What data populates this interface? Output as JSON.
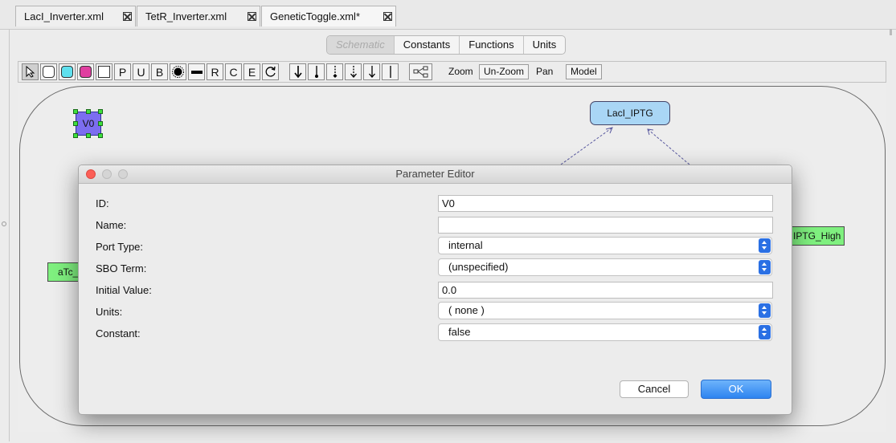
{
  "file_tabs": [
    {
      "label": "LacI_Inverter.xml"
    },
    {
      "label": "TetR_Inverter.xml"
    },
    {
      "label": "GeneticToggle.xml*"
    }
  ],
  "mode_tabs": [
    "Schematic",
    "Constants",
    "Functions",
    "Units"
  ],
  "toolbar": {
    "letter_tools": [
      "P",
      "U",
      "B",
      "R",
      "C",
      "E"
    ],
    "zoom": "Zoom",
    "unzoom": "Un-Zoom",
    "pan": "Pan",
    "model": "Model"
  },
  "canvas": {
    "v0_label": "V0",
    "lacl_label": "LacI_IPTG",
    "atc_label": "aTc_",
    "iptg_label": "IPTG_High"
  },
  "dialog": {
    "title": "Parameter Editor",
    "fields": {
      "id": {
        "label": "ID:",
        "value": "V0"
      },
      "name": {
        "label": "Name:",
        "value": ""
      },
      "port_type": {
        "label": "Port Type:",
        "value": "internal"
      },
      "sbo_term": {
        "label": "SBO Term:",
        "value": "(unspecified)"
      },
      "initial_value": {
        "label": "Initial Value:",
        "value": "0.0"
      },
      "units": {
        "label": "Units:",
        "value": "( none )"
      },
      "constant": {
        "label": "Constant:",
        "value": "false"
      }
    },
    "cancel": "Cancel",
    "ok": "OK"
  },
  "colors": {
    "species_v0": "#7c6df0",
    "complex_lacl": "#a9d6f5",
    "promoter_green": "#7ff07f",
    "ok_button": "#2e84f0"
  }
}
